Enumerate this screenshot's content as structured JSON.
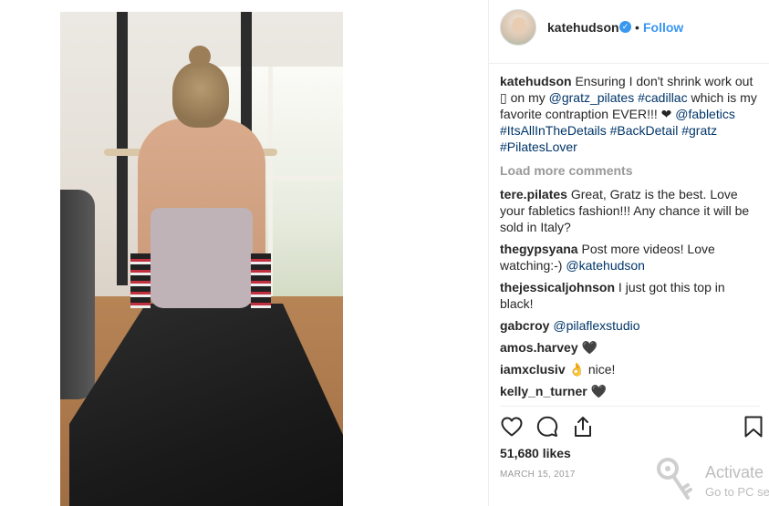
{
  "post": {
    "image_alt": "",
    "header": {
      "username": "katehudson",
      "verified_glyph": "✓",
      "separator": "•",
      "follow_label": "Follow"
    },
    "caption": {
      "user": "katehudson",
      "text_parts": [
        {
          "type": "text",
          "value": " Ensuring I don't shrink work out "
        },
        {
          "type": "text",
          "value": "▯"
        },
        {
          "type": "text",
          "value": " on my "
        },
        {
          "type": "tag",
          "value": "@gratz_pilates"
        },
        {
          "type": "text",
          "value": " "
        },
        {
          "type": "tag",
          "value": "#cadillac"
        },
        {
          "type": "text",
          "value": " which is my favorite contraption EVER!!! ❤"
        },
        {
          "type": "text",
          "value": " "
        },
        {
          "type": "tag",
          "value": "@fabletics"
        },
        {
          "type": "text",
          "value": " "
        },
        {
          "type": "tag",
          "value": "#ItsAllInTheDetails"
        },
        {
          "type": "text",
          "value": " "
        },
        {
          "type": "tag",
          "value": "#BackDetail"
        },
        {
          "type": "text",
          "value": " "
        },
        {
          "type": "tag",
          "value": "#gratz"
        },
        {
          "type": "text",
          "value": " "
        },
        {
          "type": "tag",
          "value": "#PilatesLover"
        }
      ]
    },
    "load_more_label": "Load more comments",
    "comments": [
      {
        "user": "tere.pilates",
        "parts": [
          {
            "type": "text",
            "value": " Great, Gratz is the best. Love your fabletics fashion!!! Any chance it will be sold in Italy?"
          }
        ]
      },
      {
        "user": "thegypsyana",
        "parts": [
          {
            "type": "text",
            "value": " Post more videos! Love watching:-) "
          },
          {
            "type": "tag",
            "value": "@katehudson"
          }
        ]
      },
      {
        "user": "thejessicaljohnson",
        "parts": [
          {
            "type": "text",
            "value": " I just got this top in black!"
          }
        ]
      },
      {
        "user": "gabcroy",
        "parts": [
          {
            "type": "text",
            "value": " "
          },
          {
            "type": "tag",
            "value": "@pilaflexstudio"
          }
        ]
      },
      {
        "user": "amos.harvey",
        "parts": [
          {
            "type": "text",
            "value": " 🖤"
          }
        ]
      },
      {
        "user": "iamxclusiv",
        "parts": [
          {
            "type": "text",
            "value": " 👌 nice!"
          }
        ]
      },
      {
        "user": "kelly_n_turner",
        "parts": [
          {
            "type": "text",
            "value": " 🖤"
          }
        ]
      }
    ],
    "actions": {
      "like_icon": "heart-icon",
      "comment_icon": "comment-icon",
      "share_icon": "share-icon",
      "save_icon": "bookmark-icon"
    },
    "likes_label": "51,680 likes",
    "date_label": "MARCH 15, 2017"
  },
  "watermark": {
    "line1": "Activate",
    "line2": "Go to PC se"
  },
  "colors": {
    "link_blue": "#3897f0",
    "tag_blue": "#003569",
    "muted": "#999999",
    "text": "#262626",
    "border": "#efefef"
  }
}
